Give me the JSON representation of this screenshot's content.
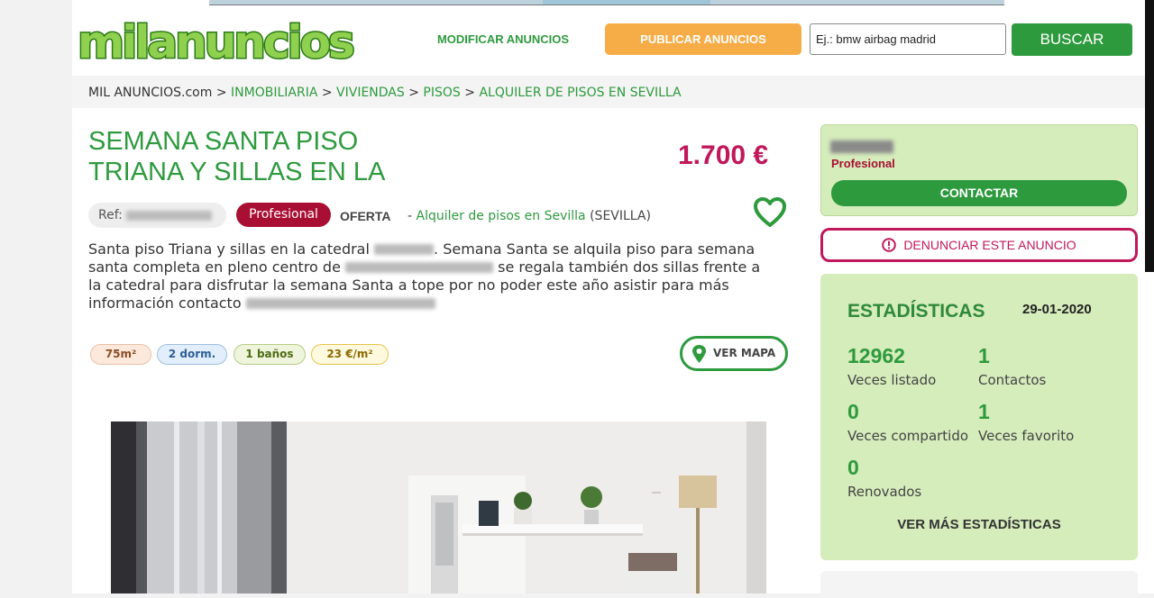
{
  "header": {
    "logo_text": "milanuncios",
    "modificar_label": "MODIFICAR ANUNCIOS",
    "publicar_label": "PUBLICAR ANUNCIOS",
    "search_value": "Ej.: bmw airbag madrid",
    "buscar_label": "BUSCAR"
  },
  "breadcrumb": {
    "root": "MIL ANUNCIOS.com",
    "items": [
      "INMOBILIARIA",
      "VIVIENDAS",
      "PISOS",
      "ALQUILER DE PISOS EN SEVILLA"
    ],
    "separator": ">"
  },
  "listing": {
    "title": "SEMANA SANTA PISO TRIANA Y SILLAS EN LA",
    "price": "1.700 €",
    "ref_label": "Ref:",
    "seller_badge": "Profesional",
    "type": "OFERTA",
    "category_dash": "-",
    "category_link": "Alquiler de pisos en Sevilla",
    "location": "(SEVILLA)",
    "description": {
      "p1": "Santa piso Triana y sillas en la catedral",
      "p2": ". Semana Santa se alquila piso para semana santa completa en pleno centro de",
      "p3": "se regala también dos sillas frente a la catedral para disfrutar la semana Santa a tope por no poder este año asistir para más información contacto"
    },
    "features": {
      "area": "75m²",
      "dorms": "2 dorm.",
      "banos": "1 baños",
      "precio_m2": "23 €/m²"
    },
    "map_button": "VER MAPA"
  },
  "seller": {
    "type": "Profesional",
    "contact_button": "CONTACTAR"
  },
  "report_button": "DENUNCIAR ESTE ANUNCIO",
  "stats": {
    "title": "ESTADÍSTICAS",
    "date": "29-01-2020",
    "items": [
      {
        "value": "12962",
        "label": "Veces listado"
      },
      {
        "value": "1",
        "label": "Contactos"
      },
      {
        "value": "0",
        "label": "Veces compartido"
      },
      {
        "value": "1",
        "label": "Veces favorito"
      },
      {
        "value": "0",
        "label": "Renovados"
      }
    ],
    "more_label": "VER MÁS ESTADÍSTICAS"
  },
  "colors": {
    "brand_green": "#2e9a3e",
    "price_magenta": "#c0185a",
    "badge_red": "#a80f33",
    "publicar_orange": "#f7ad47",
    "card_green": "#d5ecbb"
  },
  "icons": {
    "favorite": "heart-outline-icon",
    "map": "map-pin-icon",
    "report": "alert-circle-icon"
  }
}
